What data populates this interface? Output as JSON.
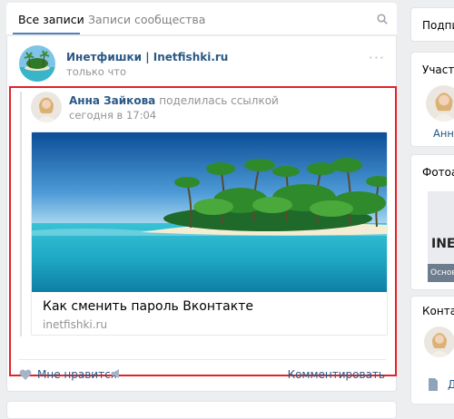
{
  "tabs": {
    "all_posts": "Все записи",
    "community_posts": "Записи сообщества"
  },
  "post": {
    "author": "Инетфишки | Inetfishki.ru",
    "time": "только что",
    "more": "···",
    "repost": {
      "author": "Анна Зайкова",
      "action": "поделилась ссылкой",
      "time": "сегодня в 17:04",
      "link": {
        "title": "Как сменить пароль Вконтакте",
        "domain": "inetfishki.ru"
      }
    },
    "actions": {
      "like": "Мне нравится",
      "comment": "Комментировать"
    }
  },
  "sidebar": {
    "subscribe": "Подпис",
    "members_title": "Участн",
    "member_name": "Анна",
    "photos_title": "Фотоал",
    "album_logo": "INE",
    "album_caption": "Основ",
    "contacts_title": "Контак",
    "doc_label": "Д"
  },
  "colors": {
    "accent": "#5181b8",
    "link": "#2a5885",
    "highlight_border": "#e2232a",
    "background": "#edeef0"
  }
}
